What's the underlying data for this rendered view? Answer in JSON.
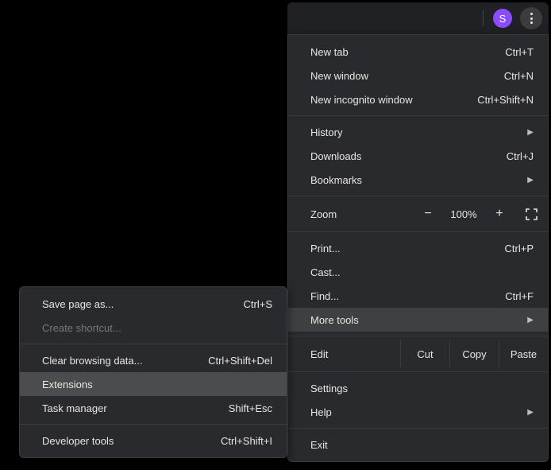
{
  "toolbar": {
    "avatar_letter": "S"
  },
  "menu": {
    "new_tab": "New tab",
    "new_tab_sc": "Ctrl+T",
    "new_window": "New window",
    "new_window_sc": "Ctrl+N",
    "new_incognito": "New incognito window",
    "new_incognito_sc": "Ctrl+Shift+N",
    "history": "History",
    "downloads": "Downloads",
    "downloads_sc": "Ctrl+J",
    "bookmarks": "Bookmarks",
    "zoom_label": "Zoom",
    "zoom_minus": "−",
    "zoom_value": "100%",
    "zoom_plus": "+",
    "print": "Print...",
    "print_sc": "Ctrl+P",
    "cast": "Cast...",
    "find": "Find...",
    "find_sc": "Ctrl+F",
    "more_tools": "More tools",
    "edit_label": "Edit",
    "cut": "Cut",
    "copy": "Copy",
    "paste": "Paste",
    "settings": "Settings",
    "help": "Help",
    "exit": "Exit"
  },
  "submenu": {
    "save_page": "Save page as...",
    "save_page_sc": "Ctrl+S",
    "create_shortcut": "Create shortcut...",
    "clear_data": "Clear browsing data...",
    "clear_data_sc": "Ctrl+Shift+Del",
    "extensions": "Extensions",
    "task_manager": "Task manager",
    "task_manager_sc": "Shift+Esc",
    "dev_tools": "Developer tools",
    "dev_tools_sc": "Ctrl+Shift+I"
  }
}
